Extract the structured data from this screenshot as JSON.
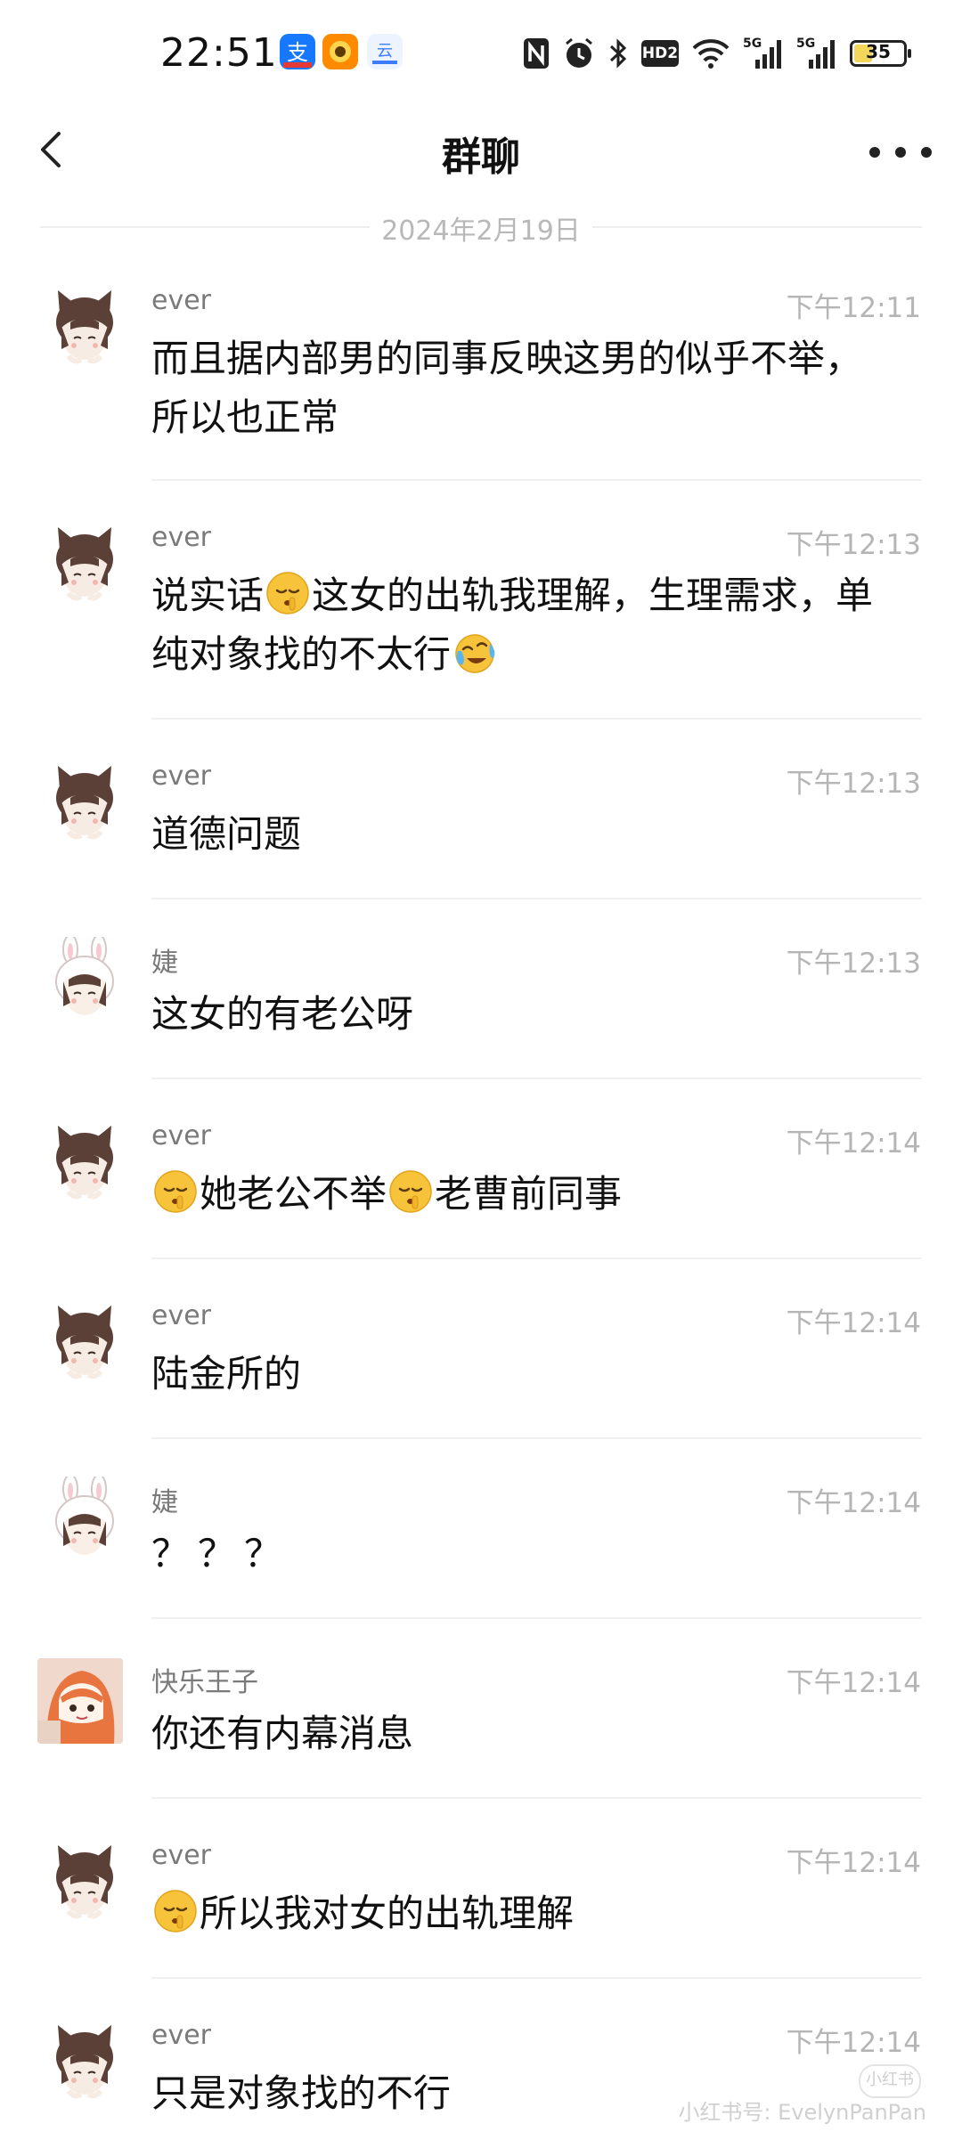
{
  "status_bar": {
    "time": "22:51",
    "network_1": "5G",
    "network_2": "5G",
    "hd": "HD2",
    "battery": "35",
    "battery_fraction": 0.35,
    "icons": [
      "alipay-icon",
      "taobao-icon",
      "cloud-app-icon",
      "nfc-icon",
      "alarm-icon",
      "bluetooth-icon",
      "hd-icon",
      "wifi-icon",
      "signal-icon",
      "signal-icon",
      "battery-icon"
    ]
  },
  "nav": {
    "title": "群聊",
    "back_icon": "chevron-left-icon",
    "more_icon": "more-dots-icon"
  },
  "date_separator": "2024年2月19日",
  "messages": [
    {
      "sender": "ever",
      "time": "下午12:11",
      "text": "而且据内部男的同事反映这男的似乎不举，所以也正常",
      "avatar": "cat-girl"
    },
    {
      "sender": "ever",
      "time": "下午12:13",
      "parts": [
        "说实话",
        "这女的出轨我理解，生理需求，单纯对象找的不太行",
        ""
      ],
      "avatar": "cat-girl"
    },
    {
      "sender": "ever",
      "time": "下午12:13",
      "text": "道德问题",
      "avatar": "cat-girl"
    },
    {
      "sender": "婕",
      "time": "下午12:13",
      "text": "这女的有老公呀",
      "avatar": "bunny-girl"
    },
    {
      "sender": "ever",
      "time": "下午12:14",
      "parts": [
        "",
        "她老公不举",
        "老曹前同事"
      ],
      "avatar": "cat-girl"
    },
    {
      "sender": "ever",
      "time": "下午12:14",
      "text": "陆金所的",
      "avatar": "cat-girl"
    },
    {
      "sender": "婕",
      "time": "下午12:14",
      "text": "？？？",
      "avatar": "bunny-girl"
    },
    {
      "sender": "快乐王子",
      "time": "下午12:14",
      "text": "你还有内幕消息",
      "avatar": "photo"
    },
    {
      "sender": "ever",
      "time": "下午12:14",
      "parts": [
        "",
        "所以我对女的出轨理解"
      ],
      "avatar": "cat-girl"
    },
    {
      "sender": "ever",
      "time": "下午12:14",
      "text": "只是对象找的不行",
      "avatar": "cat-girl"
    }
  ],
  "emojis": {
    "shushing": "shushing-face-emoji",
    "crying": "crying-laughing-emoji"
  },
  "watermark": {
    "badge": "小红书",
    "text": "小红书号: EvelynPanPan"
  }
}
